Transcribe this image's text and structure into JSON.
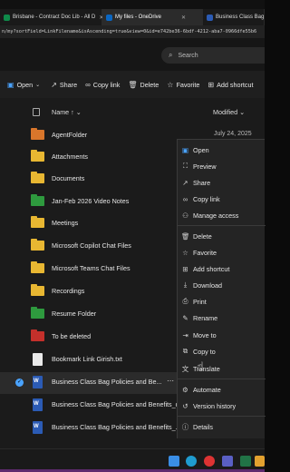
{
  "browser": {
    "tabs": [
      {
        "label": "Brisbane - Contract Doc Lib - All D",
        "color": "#0f8a4a",
        "active": false
      },
      {
        "label": "My files - OneDrive",
        "color": "#0a66c2",
        "active": true
      },
      {
        "label": "Business Class Bag",
        "color": "#2b5bb5",
        "active": false
      }
    ],
    "url": "n/my?sortField=LinkFilename&isAscending=true&view=0&id=e742be36-6bdf-4212-aba7-0966dfe55b6"
  },
  "search": {
    "placeholder": "Search",
    "icon": "search-icon"
  },
  "toolbar": {
    "open": "Open",
    "share": "Share",
    "copy_link": "Copy link",
    "delete": "Delete",
    "favorite": "Favorite",
    "add_shortcut": "Add shortcut"
  },
  "columns": {
    "name": "Name",
    "modified": "Modified"
  },
  "files": [
    {
      "name": "AgentFolder",
      "modified": "July 24, 2025",
      "type": "folder",
      "color": "#d9762b"
    },
    {
      "name": "Attachments",
      "modified": "",
      "type": "folder",
      "color": "#e8b732"
    },
    {
      "name": "Documents",
      "modified": "",
      "type": "folder",
      "color": "#e8b732"
    },
    {
      "name": "Jan-Feb 2026 Video Notes",
      "modified": "",
      "type": "folder",
      "color": "#2e9a3e"
    },
    {
      "name": "Meetings",
      "modified": "",
      "type": "folder",
      "color": "#e8b732"
    },
    {
      "name": "Microsoft Copilot Chat Files",
      "modified": "",
      "type": "folder",
      "color": "#e8b732"
    },
    {
      "name": "Microsoft Teams Chat Files",
      "modified": "",
      "type": "folder",
      "color": "#e8b732"
    },
    {
      "name": "Recordings",
      "modified": "",
      "type": "folder",
      "color": "#e8b732"
    },
    {
      "name": "Resume Folder",
      "modified": "",
      "type": "folder",
      "color": "#2e9a3e"
    },
    {
      "name": "To be deleted",
      "modified": "",
      "type": "folder",
      "color": "#c4302b"
    },
    {
      "name": "Bookmark Link Girish.txt",
      "modified": "",
      "type": "txt"
    },
    {
      "name": "Business Class Bag Policies and Be...",
      "modified": "",
      "type": "word",
      "selected": true
    },
    {
      "name": "Business Class Bag Policies and Benefits_de...",
      "modified": "",
      "type": "word"
    },
    {
      "name": "Business Class Bag Policies and Benefits_...",
      "modified": "",
      "type": "word"
    }
  ],
  "context_menu": [
    {
      "label": "Open",
      "icon": "open-icon"
    },
    {
      "label": "Preview",
      "icon": "preview-icon"
    },
    {
      "label": "Share",
      "icon": "share-icon"
    },
    {
      "label": "Copy link",
      "icon": "link-icon"
    },
    {
      "label": "Manage access",
      "icon": "manage-access-icon"
    },
    {
      "label": "Delete",
      "icon": "trash-icon"
    },
    {
      "label": "Favorite",
      "icon": "star-icon"
    },
    {
      "label": "Add shortcut",
      "icon": "shortcut-icon"
    },
    {
      "label": "Download",
      "icon": "download-icon"
    },
    {
      "label": "Print",
      "icon": "print-icon"
    },
    {
      "label": "Rename",
      "icon": "rename-icon"
    },
    {
      "label": "Move to",
      "icon": "move-icon"
    },
    {
      "label": "Copy to",
      "icon": "copy-icon"
    },
    {
      "label": "Translate",
      "icon": "translate-icon"
    },
    {
      "label": "Automate",
      "icon": "automate-icon"
    },
    {
      "label": "Version history",
      "icon": "history-icon"
    },
    {
      "label": "Details",
      "icon": "info-icon"
    }
  ]
}
